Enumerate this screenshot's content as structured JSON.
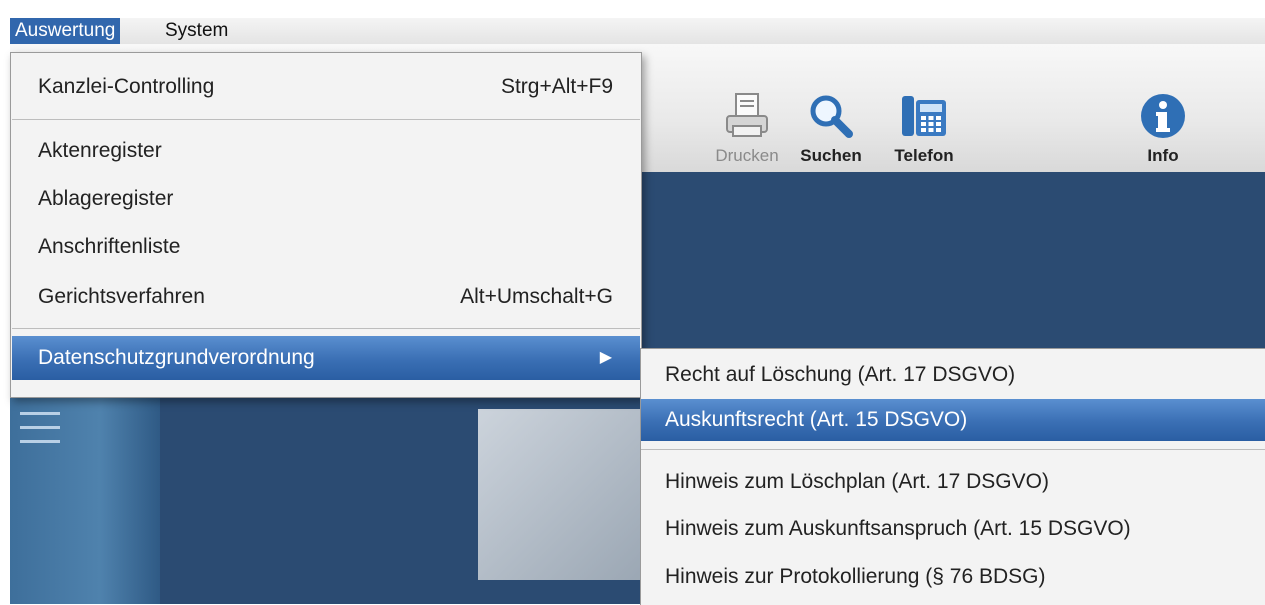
{
  "menubar": {
    "items": [
      {
        "label": "Auswertung",
        "active": true
      },
      {
        "label": "System",
        "active": false
      }
    ]
  },
  "toolbar": {
    "buttons": [
      {
        "label": "Drucken",
        "icon": "printer-icon",
        "enabled": false
      },
      {
        "label": "Suchen",
        "icon": "search-icon",
        "enabled": true
      },
      {
        "label": "Telefon",
        "icon": "phone-icon",
        "enabled": true
      },
      {
        "label": "Info",
        "icon": "info-icon",
        "enabled": true
      }
    ]
  },
  "dropdown": {
    "items": [
      {
        "label": "Kanzlei-Controlling",
        "shortcut": "Strg+Alt+F9"
      },
      {
        "label": "Aktenregister",
        "shortcut": ""
      },
      {
        "label": "Ablageregister",
        "shortcut": ""
      },
      {
        "label": "Anschriftenliste",
        "shortcut": ""
      },
      {
        "label": "Gerichtsverfahren",
        "shortcut": "Alt+Umschalt+G"
      },
      {
        "label": "Datenschutzgrundverordnung",
        "shortcut": "",
        "submenu": true,
        "highlighted": true
      }
    ],
    "submenu_arrow": "▶"
  },
  "submenu": {
    "items": [
      {
        "label": "Recht auf Löschung (Art. 17 DSGVO)"
      },
      {
        "label": "Auskunftsrecht (Art. 15 DSGVO)",
        "highlighted": true
      },
      {
        "label": "Hinweis zum Löschplan (Art. 17 DSGVO)"
      },
      {
        "label": "Hinweis zum Auskunftsanspruch (Art. 15 DSGVO)"
      },
      {
        "label": "Hinweis zur Protokollierung (§ 76 BDSG)"
      }
    ]
  },
  "colors": {
    "menu_highlight": "#3a6fb4",
    "navy_background": "#2b4b72",
    "menu_background": "#f3f3f3",
    "info_blue": "#2f6fb5"
  }
}
